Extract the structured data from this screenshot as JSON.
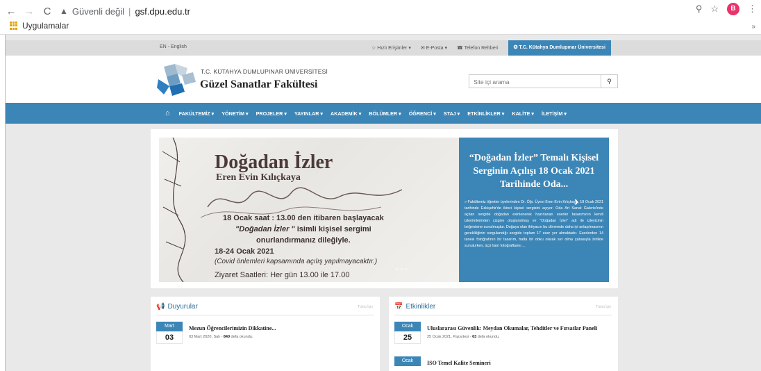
{
  "browser": {
    "security_label": "Güvenli değil",
    "url": "gsf.dpu.edu.tr",
    "profile_initial": "B",
    "bookmarks_label": "Uygulamalar"
  },
  "topbar": {
    "lang": "EN - English",
    "quick_access": "☆ Hızlı Erişimler ▾",
    "email": "✉ E-Posta ▾",
    "phone_book": "☎ Telefon Rehberi",
    "university": "✪ T.C. Kütahya Dumlupınar Üniversitesi"
  },
  "header": {
    "subtitle": "T.C. KÜTAHYA DUMLUPINAR ÜNİVERSİTESİ",
    "title": "Güzel Sanatlar Fakültesi",
    "search_placeholder": "Site içi arama"
  },
  "nav": {
    "items": [
      "FAKÜLTEMİZ ▾",
      "YÖNETİM ▾",
      "PROJELER ▾",
      "YAYINLAR ▾",
      "AKADEMİK ▾",
      "BÖLÜMLER ▾",
      "ÖĞRENCİ ▾",
      "STAJ ▾",
      "ETKİNLİKLER ▾",
      "KALİTE ▾",
      "İLETİŞİM ▾"
    ]
  },
  "slider": {
    "image": {
      "title": "Doğadan İzler",
      "artist": "Eren Evin Kılıçkaya",
      "line1": "18 Ocak saat : 13.00 den itibaren  başlayacak",
      "line2_italic": "\"Doğadan İzler \"",
      "line2_rest": " isimli kişisel sergimi",
      "line3": "onurlandırmanız dileğiyle.",
      "dates": "18-24 Ocak  2021",
      "covid": "(Covid önlemleri kapsamında açılış yapılmayacaktır.)",
      "hours": "Ziyaret Saatleri: Her gün 13.00 ile 17.00"
    },
    "headline": "“Doğadan İzler” Temalı Kişisel Serginin Açılışı 18 Ocak 2021 Tarihinde Oda...",
    "summary": "» Fakültemiz öğretim üyelerinden Dr. Öğr. Üyesi Eren Evin Kılıçkaya, 18 Ocak 2021 tarihinde Eskişehir'de ikinci kişisel sergisini açıyor. Oda Art Sanat Galerisi'nde açılan sergide doğadan esinlenerek hazırlanan eserler tasarımının kendi izlenimlerinden çizgiye oluşturulmuş ve \"Doğadan İzler\" adı ile izleyicinin beğenisine sunulmuştur. Doğaya olan ihtiyacın bu dönemde daha iyi anlaşılmasının gerekliliğinin sorgulandığı sergide toplam 17 eser yer almaktadır. Eserlerden 14 tanesi fotoğrafının bir tasarım, hatta bir doku olarak ser olma çabasıyla birlikte sunulurken, üçü ham fotoğraflarını ..."
  },
  "announcements": {
    "title": "Duyurular",
    "all_label": "Tümü İçin",
    "items": [
      {
        "month": "Mart",
        "day": "03",
        "title": "Mezun Öğrencilerimizin Dikkatine...",
        "meta_date": "03 Mart 2020, Salı - ",
        "views": "840",
        "meta_suffix": " defa okundu."
      }
    ]
  },
  "events": {
    "title": "Etkinlikler",
    "all_label": "Tümü İçin",
    "items": [
      {
        "month": "Ocak",
        "day": "25",
        "title": "Uluslararası Güvenlik: Meydan Okumalar, Tehditler ve Fırsatlar Paneli",
        "meta_date": "25 Ocak 2021, Pazartesi - ",
        "views": "63",
        "meta_suffix": " defa okundu."
      },
      {
        "month": "Ocak",
        "title": "ISO Temel Kalite Semineri"
      }
    ]
  }
}
